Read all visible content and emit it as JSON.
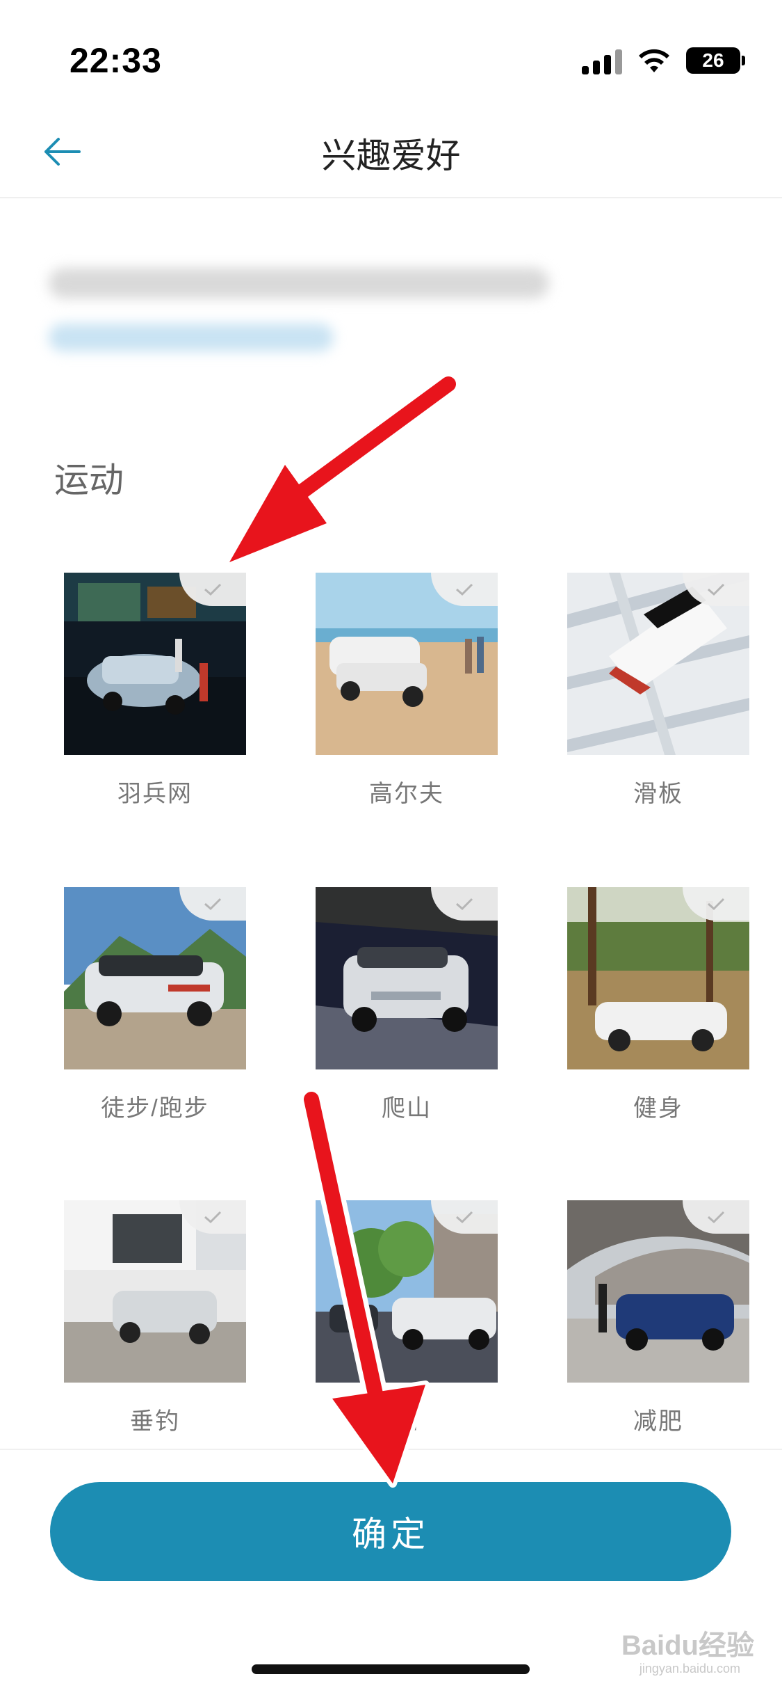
{
  "status_bar": {
    "time": "22:33",
    "battery": "26"
  },
  "nav": {
    "title": "兴趣爱好"
  },
  "section": {
    "title": "运动"
  },
  "interests": [
    {
      "label": "羽兵网",
      "icon": "photo-night-street-suv"
    },
    {
      "label": "高尔夫",
      "icon": "photo-beach-suv"
    },
    {
      "label": "滑板",
      "icon": "photo-aerial-suv"
    },
    {
      "label": "徒步/跑步",
      "icon": "photo-mountain-suv"
    },
    {
      "label": "爬山",
      "icon": "photo-garage-suv"
    },
    {
      "label": "健身",
      "icon": "photo-field-suv"
    },
    {
      "label": "垂钓",
      "icon": "photo-house-suv"
    },
    {
      "label": "伽",
      "icon": "photo-trees-suv"
    },
    {
      "label": "减肥",
      "icon": "photo-plaza-suv"
    }
  ],
  "confirm": {
    "label": "确定"
  },
  "watermark": {
    "brand": "Baidu经验",
    "url": "jingyan.baidu.com"
  },
  "colors": {
    "accent": "#1c8db3",
    "arrow": "#e8141c"
  }
}
